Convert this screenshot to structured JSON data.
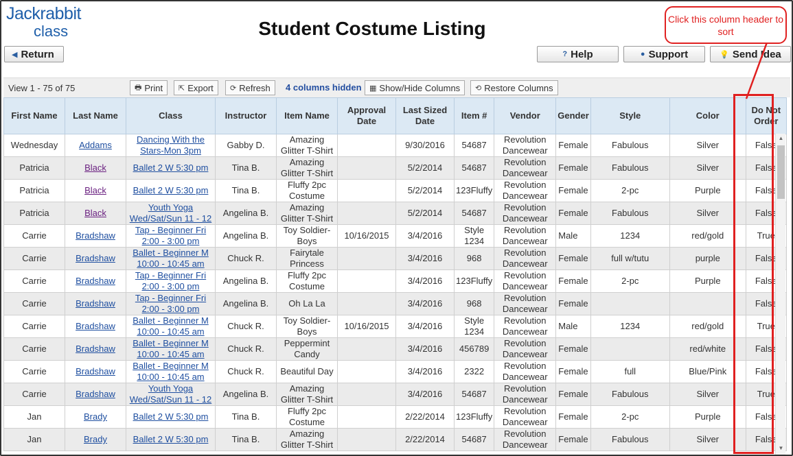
{
  "logo": {
    "line1": "Jackrabbit",
    "line2": "class"
  },
  "page_title": "Student Costume Listing",
  "nav": {
    "return_label": "Return",
    "help_label": "Help",
    "support_label": "Support",
    "idea_label": "Send Idea"
  },
  "toolbar": {
    "view_count": "View 1 - 75 of 75",
    "print_label": "Print",
    "export_label": "Export",
    "refresh_label": "Refresh",
    "hidden_columns": "4 columns hidden",
    "show_hide_label": "Show/Hide Columns",
    "restore_label": "Restore Columns"
  },
  "table": {
    "headers": [
      "First Name",
      "Last Name",
      "Class",
      "Instructor",
      "Item Name",
      "Approval Date",
      "Last Sized Date",
      "Item #",
      "Vendor",
      "Gender",
      "Style",
      "Color",
      "Do Not Order"
    ],
    "rows": [
      [
        "Wednesday",
        "Addams",
        "Dancing With the Stars-Mon 3pm",
        "Gabby D.",
        "Amazing Glitter T-Shirt",
        "",
        "9/30/2016",
        "54687",
        "Revolution Dancewear",
        "Female",
        "Fabulous",
        "Silver",
        "False"
      ],
      [
        "Patricia",
        "Black",
        "Ballet 2 W 5:30 pm",
        "Tina B.",
        "Amazing Glitter T-Shirt",
        "",
        "5/2/2014",
        "54687",
        "Revolution Dancewear",
        "Female",
        "Fabulous",
        "Silver",
        "False"
      ],
      [
        "Patricia",
        "Black",
        "Ballet 2 W 5:30 pm",
        "Tina B.",
        "Fluffy 2pc Costume",
        "",
        "5/2/2014",
        "123Fluffy",
        "Revolution Dancewear",
        "Female",
        "2-pc",
        "Purple",
        "False"
      ],
      [
        "Patricia",
        "Black",
        "Youth Yoga Wed/Sat/Sun 11 - 12",
        "Angelina B.",
        "Amazing Glitter T-Shirt",
        "",
        "5/2/2014",
        "54687",
        "Revolution Dancewear",
        "Female",
        "Fabulous",
        "Silver",
        "False"
      ],
      [
        "Carrie",
        "Bradshaw",
        "Tap - Beginner Fri 2:00 - 3:00 pm",
        "Angelina B.",
        "Toy Soldier-Boys",
        "10/16/2015",
        "3/4/2016",
        "Style 1234",
        "Revolution Dancewear",
        "Male",
        "1234",
        "red/gold",
        "True"
      ],
      [
        "Carrie",
        "Bradshaw",
        "Ballet - Beginner M 10:00 - 10:45 am",
        "Chuck R.",
        "Fairytale Princess",
        "",
        "3/4/2016",
        "968",
        "Revolution Dancewear",
        "Female",
        "full w/tutu",
        "purple",
        "False"
      ],
      [
        "Carrie",
        "Bradshaw",
        "Tap - Beginner Fri 2:00 - 3:00 pm",
        "Angelina B.",
        "Fluffy 2pc Costume",
        "",
        "3/4/2016",
        "123Fluffy",
        "Revolution Dancewear",
        "Female",
        "2-pc",
        "Purple",
        "False"
      ],
      [
        "Carrie",
        "Bradshaw",
        "Tap - Beginner Fri 2:00 - 3:00 pm",
        "Angelina B.",
        "Oh La La",
        "",
        "3/4/2016",
        "968",
        "Revolution Dancewear",
        "Female",
        "",
        "",
        "False"
      ],
      [
        "Carrie",
        "Bradshaw",
        "Ballet - Beginner M 10:00 - 10:45 am",
        "Chuck R.",
        "Toy Soldier-Boys",
        "10/16/2015",
        "3/4/2016",
        "Style 1234",
        "Revolution Dancewear",
        "Male",
        "1234",
        "red/gold",
        "True"
      ],
      [
        "Carrie",
        "Bradshaw",
        "Ballet - Beginner M 10:00 - 10:45 am",
        "Chuck R.",
        "Peppermint Candy",
        "",
        "3/4/2016",
        "456789",
        "Revolution Dancewear",
        "Female",
        "",
        "red/white",
        "False"
      ],
      [
        "Carrie",
        "Bradshaw",
        "Ballet - Beginner M 10:00 - 10:45 am",
        "Chuck R.",
        "Beautiful Day",
        "",
        "3/4/2016",
        "2322",
        "Revolution Dancewear",
        "Female",
        "full",
        "Blue/Pink",
        "False"
      ],
      [
        "Carrie",
        "Bradshaw",
        "Youth Yoga Wed/Sat/Sun 11 - 12",
        "Angelina B.",
        "Amazing Glitter T-Shirt",
        "",
        "3/4/2016",
        "54687",
        "Revolution Dancewear",
        "Female",
        "Fabulous",
        "Silver",
        "True"
      ],
      [
        "Jan",
        "Brady",
        "Ballet 2 W 5:30 pm",
        "Tina B.",
        "Fluffy 2pc Costume",
        "",
        "2/22/2014",
        "123Fluffy",
        "Revolution Dancewear",
        "Female",
        "2-pc",
        "Purple",
        "False"
      ],
      [
        "Jan",
        "Brady",
        "Ballet 2 W 5:30 pm",
        "Tina B.",
        "Amazing Glitter T-Shirt",
        "",
        "2/22/2014",
        "54687",
        "Revolution Dancewear",
        "Female",
        "Fabulous",
        "Silver",
        "False"
      ]
    ]
  },
  "annotation": {
    "callout_text": "Click this column header to sort",
    "color": "#e02020"
  },
  "colors": {
    "link": "#1f4fa0",
    "visited_link": "#6a2080",
    "header_bg": "#dce9f4",
    "logo": "#1f5faa"
  }
}
